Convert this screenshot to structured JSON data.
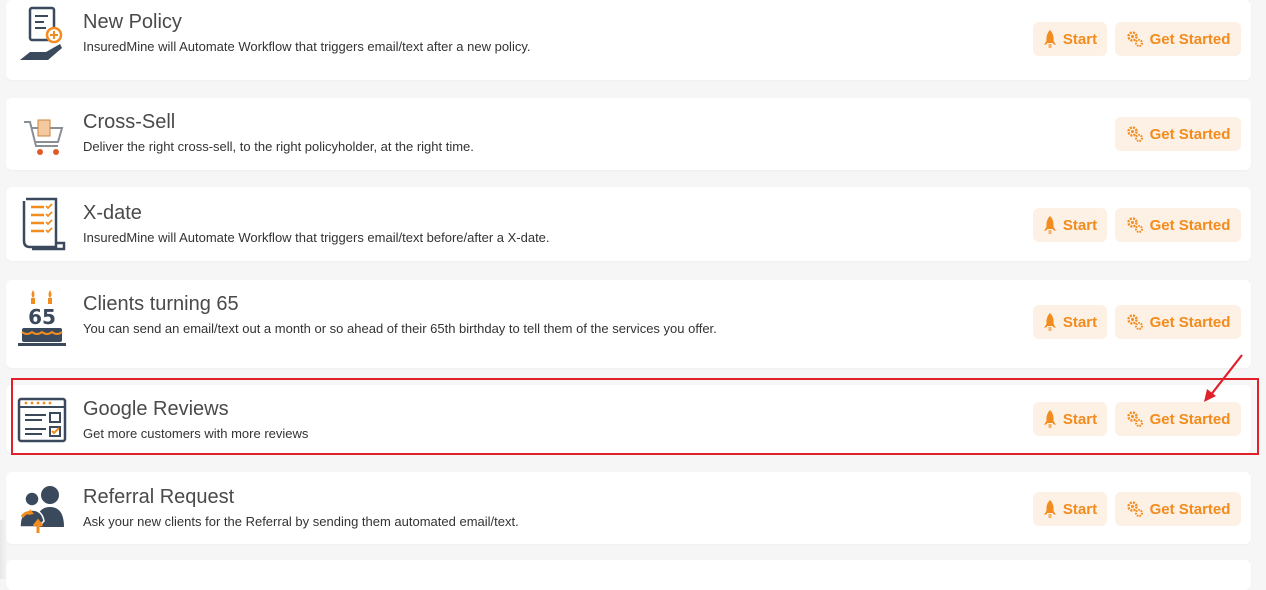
{
  "cards": [
    {
      "title": "New Policy",
      "description": "InsuredMine will Automate Workflow that triggers email/text after a new policy.",
      "has_start": true
    },
    {
      "title": "Cross-Sell",
      "description": "Deliver the right cross-sell, to the right policyholder, at the right time.",
      "has_start": false
    },
    {
      "title": "X-date",
      "description": "InsuredMine will Automate Workflow that triggers email/text before/after a X-date.",
      "has_start": true
    },
    {
      "title": "Clients turning 65",
      "description": "You can send an email/text out a month or so ahead of their 65th birthday to tell them of the services you offer.",
      "has_start": true
    },
    {
      "title": "Google Reviews",
      "description": "Get more customers with more reviews",
      "has_start": true,
      "highlighted": true
    },
    {
      "title": "Referral Request",
      "description": "Ask your new clients for the Referral by sending them automated email/text.",
      "has_start": true
    }
  ],
  "buttons": {
    "start_label": "Start",
    "get_started_label": "Get Started"
  },
  "icons": {
    "new_policy": "document-in-hand-icon",
    "cross_sell": "shopping-cart-icon",
    "x_date": "checklist-scroll-icon",
    "clients_65": "birthday-cake-65-icon",
    "google_reviews": "review-window-icon",
    "referral": "users-referral-icon",
    "start": "rocket-icon",
    "get_started": "gears-icon"
  },
  "colors": {
    "accent": "#f28c1e",
    "button_bg": "#fdf0e4",
    "highlight": "#e0202a",
    "icon_dark": "#3a4a5c"
  },
  "annotation": {
    "highlighted_card": "Google Reviews"
  }
}
